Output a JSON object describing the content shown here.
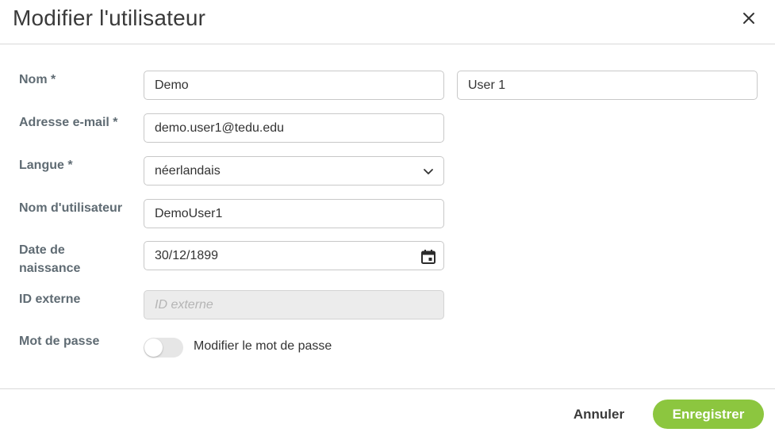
{
  "dialog": {
    "title": "Modifier l'utilisateur",
    "close_icon": "close-icon"
  },
  "form": {
    "name": {
      "label": "Nom *",
      "first_name": "Demo",
      "last_name": "User 1"
    },
    "email": {
      "label": "Adresse e-mail *",
      "value": "demo.user1@tedu.edu"
    },
    "language": {
      "label": "Langue *",
      "selected": "néerlandais",
      "icon": "chevron-down-icon"
    },
    "username": {
      "label": "Nom d'utilisateur",
      "value": "DemoUser1"
    },
    "birthdate": {
      "label_line1": "Date de",
      "label_line2": "naissance",
      "value": "30/12/1899",
      "icon": "calendar-icon"
    },
    "external_id": {
      "label": "ID externe",
      "placeholder": "ID externe",
      "value": ""
    },
    "password": {
      "label": "Mot de passe",
      "toggle_label": "Modifier le mot de passe",
      "toggle_on": false
    }
  },
  "footer": {
    "cancel_label": "Annuler",
    "save_label": "Enregistrer"
  },
  "colors": {
    "accent": "#8cc63f",
    "label": "#5f6b73",
    "border": "#c8c8c8",
    "disabled_bg": "#ececec"
  }
}
